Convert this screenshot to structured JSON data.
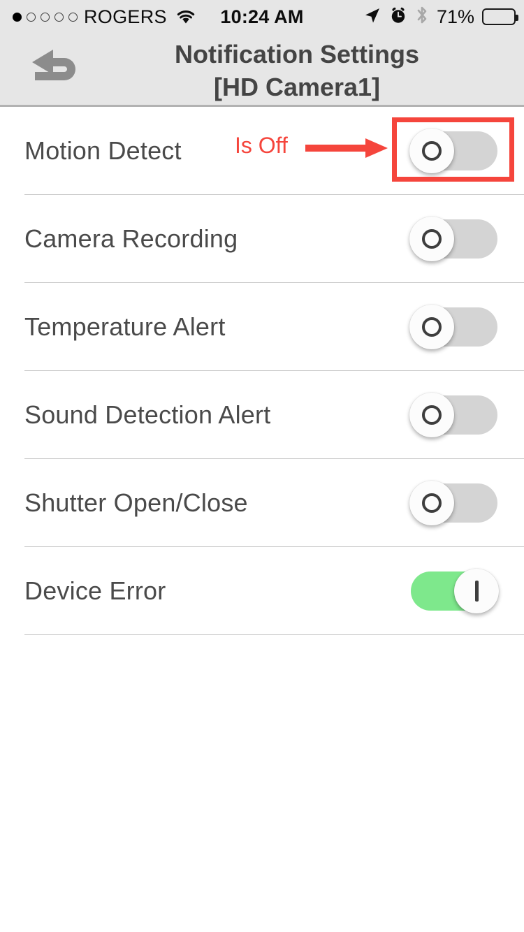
{
  "status_bar": {
    "carrier": "ROGERS",
    "signal_dots_total": 5,
    "signal_dots_filled": 1,
    "wifi_icon": "wifi-icon",
    "time": "10:24 AM",
    "location_icon": "location-arrow-icon",
    "alarm_icon": "alarm-clock-icon",
    "bluetooth_icon": "bluetooth-icon",
    "battery_percent": "71%",
    "battery_level": 71
  },
  "navbar": {
    "back_icon": "back-undo-arrow-icon",
    "title_line1": "Notification Settings",
    "title_line2": "[HD Camera1]"
  },
  "settings": {
    "rows": [
      {
        "label": "Motion Detect",
        "state": "off",
        "knob_glyph": "O"
      },
      {
        "label": "Camera Recording",
        "state": "off",
        "knob_glyph": "O"
      },
      {
        "label": "Temperature Alert",
        "state": "off",
        "knob_glyph": "O"
      },
      {
        "label": "Sound Detection Alert",
        "state": "off",
        "knob_glyph": "O"
      },
      {
        "label": "Shutter Open/Close",
        "state": "off",
        "knob_glyph": "O"
      },
      {
        "label": "Device Error",
        "state": "on",
        "knob_glyph": "I"
      }
    ]
  },
  "annotation": {
    "text": "Is Off",
    "arrow_icon": "right-arrow-annotation-icon",
    "highlight_icon": "red-highlight-box",
    "color": "#F5453C",
    "targets_row": "Motion Detect"
  },
  "colors": {
    "bar_background": "#E6E6E6",
    "page_background": "#FFFFFF",
    "label_text": "#4A4A4A",
    "title_text": "#444444",
    "switch_off_track": "#D4D4D4",
    "switch_on_track": "#7EE88C",
    "separator": "#C9C9C9",
    "annotation_red": "#F5453C"
  }
}
